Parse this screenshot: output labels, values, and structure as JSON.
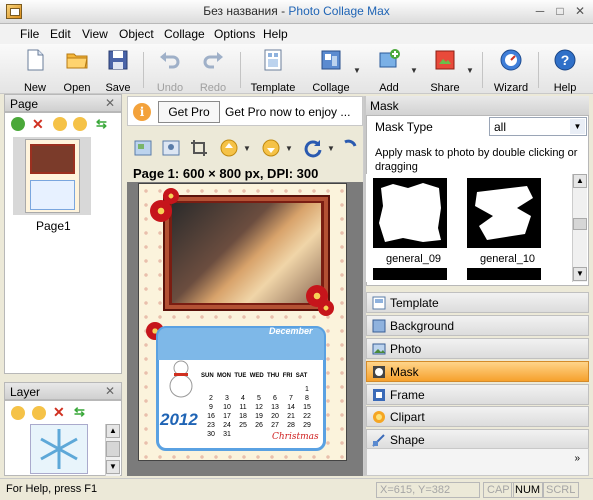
{
  "window": {
    "title_doc": "Без названия",
    "title_sep": " - ",
    "title_app": "Photo Collage Max"
  },
  "menu": [
    "File",
    "Edit",
    "View",
    "Object",
    "Collage",
    "Options",
    "Help"
  ],
  "toolbar": {
    "new": "New",
    "open": "Open",
    "save": "Save",
    "undo": "Undo",
    "redo": "Redo",
    "template": "Template",
    "collage": "Collage",
    "add": "Add",
    "share": "Share",
    "wizard": "Wizard",
    "help": "Help"
  },
  "page_panel": {
    "title": "Page",
    "thumb_label": "Page1"
  },
  "layer_panel": {
    "title": "Layer"
  },
  "getpro": {
    "info": "i",
    "button": "Get Pro",
    "text": "Get Pro now to enjoy ..."
  },
  "canvas": {
    "page_info": "Page 1: 600 × 800 px, DPI: 300",
    "calendar_month": "December",
    "calendar_days": [
      "SUN",
      "MON",
      "TUE",
      "WED",
      "THU",
      "FRI",
      "SAT"
    ],
    "calendar_rows": [
      [
        "",
        "",
        "",
        "",
        "",
        "",
        "1"
      ],
      [
        "2",
        "3",
        "4",
        "5",
        "6",
        "7",
        "8"
      ],
      [
        "9",
        "10",
        "11",
        "12",
        "13",
        "14",
        "15"
      ],
      [
        "16",
        "17",
        "18",
        "19",
        "20",
        "21",
        "22"
      ],
      [
        "23",
        "24",
        "25",
        "26",
        "27",
        "28",
        "29"
      ],
      [
        "30",
        "31",
        "",
        "",
        "",
        "",
        ""
      ]
    ],
    "calendar_year": "2012",
    "calendar_greeting": "Christmas"
  },
  "mask_panel": {
    "title": "Mask",
    "type_label": "Mask Type",
    "type_value": "all",
    "help_text": "Apply mask to photo by double clicking or dragging",
    "items": [
      "general_09",
      "general_10"
    ]
  },
  "accordion": [
    {
      "label": "Template",
      "icon": "template-icon",
      "active": false
    },
    {
      "label": "Background",
      "icon": "background-icon",
      "active": false
    },
    {
      "label": "Photo",
      "icon": "photo-icon",
      "active": false
    },
    {
      "label": "Mask",
      "icon": "mask-icon",
      "active": true
    },
    {
      "label": "Frame",
      "icon": "frame-icon",
      "active": false
    },
    {
      "label": "Clipart",
      "icon": "clipart-icon",
      "active": false
    },
    {
      "label": "Shape",
      "icon": "shape-icon",
      "active": false
    }
  ],
  "status": {
    "help": "For Help, press F1",
    "coords": "X=615, Y=382",
    "cap": "CAP",
    "num": "NUM",
    "scrl": "SCRL"
  },
  "colors": {
    "accent_active": "#f6a12d",
    "title_app": "#1f64b5"
  }
}
